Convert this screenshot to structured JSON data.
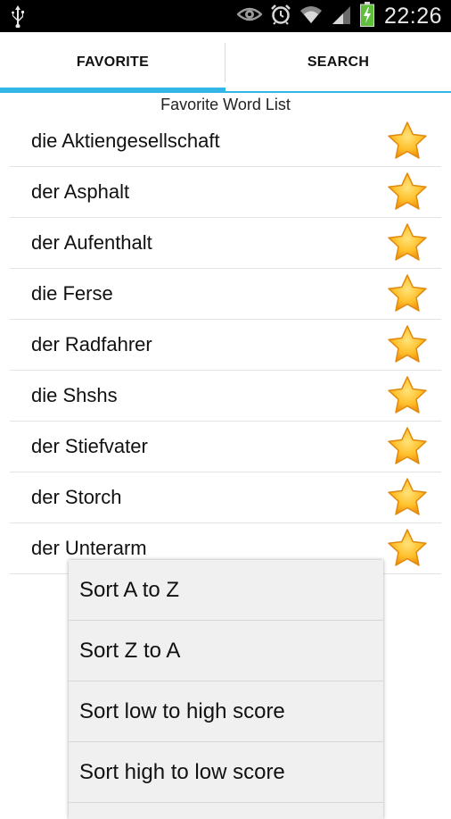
{
  "status_bar": {
    "time": "22:26",
    "icons": [
      "usb-icon",
      "eye-icon",
      "alarm-icon",
      "wifi-icon",
      "signal-icon",
      "battery-charging-icon"
    ],
    "colors": {
      "background": "#000000",
      "text": "#e8e8e8",
      "battery": "#5fbf3c"
    }
  },
  "tabs": [
    {
      "label": "FAVORITE",
      "selected": true
    },
    {
      "label": "SEARCH",
      "selected": false
    }
  ],
  "accent_color": "#33b5e5",
  "list": {
    "title": "Favorite Word List",
    "items": [
      {
        "word": "die Aktiengesellschaft",
        "favorite": true
      },
      {
        "word": "der Asphalt",
        "favorite": true
      },
      {
        "word": "der Aufenthalt",
        "favorite": true
      },
      {
        "word": "die Ferse",
        "favorite": true
      },
      {
        "word": "der Radfahrer",
        "favorite": true
      },
      {
        "word": "die Shshs",
        "favorite": true
      },
      {
        "word": "der Stiefvater",
        "favorite": true
      },
      {
        "word": "der Storch",
        "favorite": true
      },
      {
        "word": "der Unterarm",
        "favorite": true
      }
    ]
  },
  "sort_menu": {
    "items": [
      {
        "label": "Sort A to Z"
      },
      {
        "label": "Sort Z to A"
      },
      {
        "label": "Sort low to high score"
      },
      {
        "label": "Sort high to low score"
      }
    ]
  }
}
